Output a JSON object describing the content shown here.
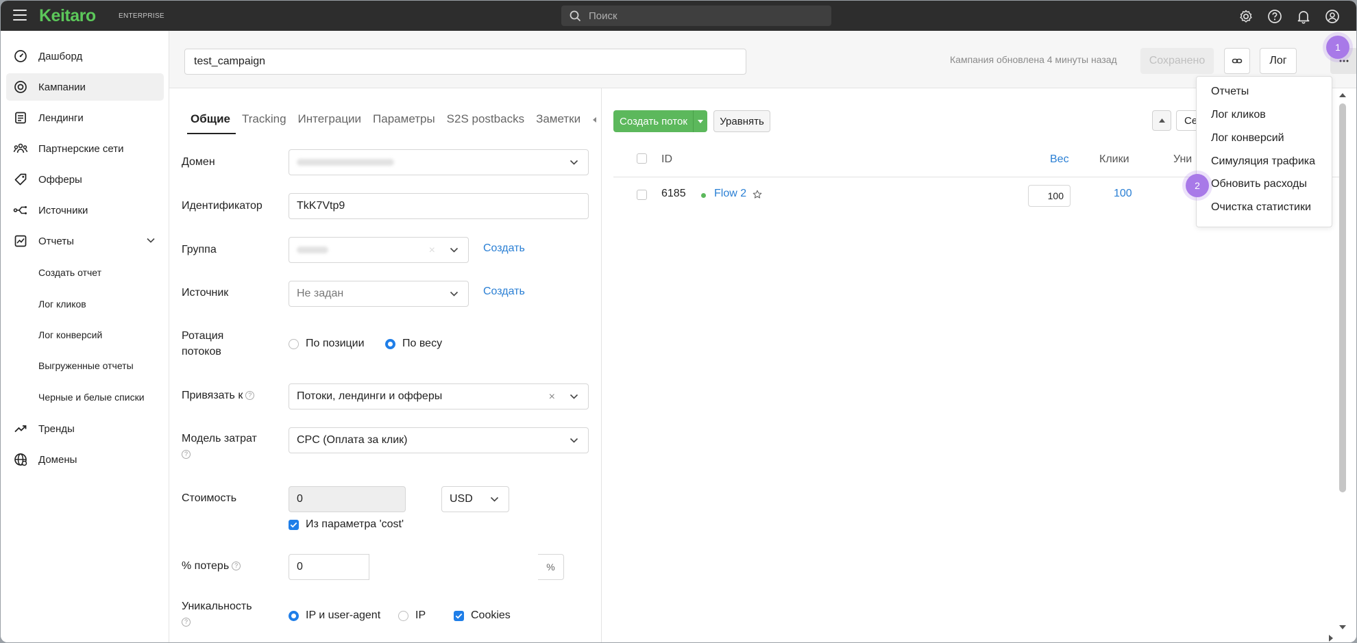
{
  "topbar": {
    "logo": "Keitaro",
    "edition": "ENTERPRISE",
    "search_placeholder": "Поиск"
  },
  "sidebar": {
    "items": [
      {
        "label": "Дашборд",
        "icon": "dashboard-icon"
      },
      {
        "label": "Кампании",
        "icon": "campaigns-icon",
        "active": true
      },
      {
        "label": "Лендинги",
        "icon": "landings-icon"
      },
      {
        "label": "Партнерские сети",
        "icon": "affiliate-networks-icon"
      },
      {
        "label": "Офферы",
        "icon": "offers-icon"
      },
      {
        "label": "Источники",
        "icon": "sources-icon"
      },
      {
        "label": "Отчеты",
        "icon": "reports-icon"
      },
      {
        "label": "Тренды",
        "icon": "trends-icon"
      },
      {
        "label": "Домены",
        "icon": "domains-icon"
      }
    ],
    "report_subitems": [
      "Создать отчет",
      "Лог кликов",
      "Лог конверсий",
      "Выгруженные отчеты",
      "Черные и белые списки"
    ]
  },
  "header": {
    "campaign_name": "test_campaign",
    "updated_text": "Кампания обновлена 4 минуты назад",
    "saved_label": "Сохранено",
    "log_label": "Лог"
  },
  "settings": {
    "tabs": [
      "Общие",
      "Tracking",
      "Интеграции",
      "Параметры",
      "S2S postbacks",
      "Заметки"
    ],
    "domain_label": "Домен",
    "identifier_label": "Идентификатор",
    "identifier_value": "TkK7Vtp9",
    "group_label": "Группа",
    "create_label": "Создать",
    "source_label": "Источник",
    "source_value": "Не задан",
    "rotation_label": "Ротация потоков",
    "rotation_options": [
      "По позиции",
      "По весу"
    ],
    "bind_label": "Привязать к",
    "bind_value": "Потоки, лендинги и офферы",
    "cost_model_label": "Модель затрат",
    "cost_model_value": "CPC (Оплата за клик)",
    "cost_label": "Стоимость",
    "cost_value": "0",
    "currency_value": "USD",
    "cost_param_label": "Из параметра 'cost'",
    "loss_label": "% потерь",
    "loss_value": "0",
    "loss_suffix": "%",
    "uniqueness_label": "Уникальность",
    "uniqueness_options": [
      "IP и user-agent",
      "IP",
      "Cookies"
    ]
  },
  "flows": {
    "create_label": "Создать поток",
    "equalize_label": "Уравнять",
    "se_label": "Се",
    "columns": {
      "id": "ID",
      "weight": "Вес",
      "clicks": "Клики",
      "unique": "Уни"
    },
    "rows": [
      {
        "id": "6185",
        "name": "Flow 2",
        "weight": "100",
        "clicks": "100"
      }
    ]
  },
  "menu": {
    "items": [
      "Отчеты",
      "Лог кликов",
      "Лог конверсий",
      "Симуляция трафика",
      "Обновить расходы",
      "Очистка статистики"
    ]
  },
  "badges": {
    "first": "1",
    "second": "2"
  },
  "colors": {
    "accent_green": "#5cb85c",
    "link_blue": "#2a7fd4",
    "badge_purple": "#a879e8",
    "topbar": "#2d2d2d"
  }
}
